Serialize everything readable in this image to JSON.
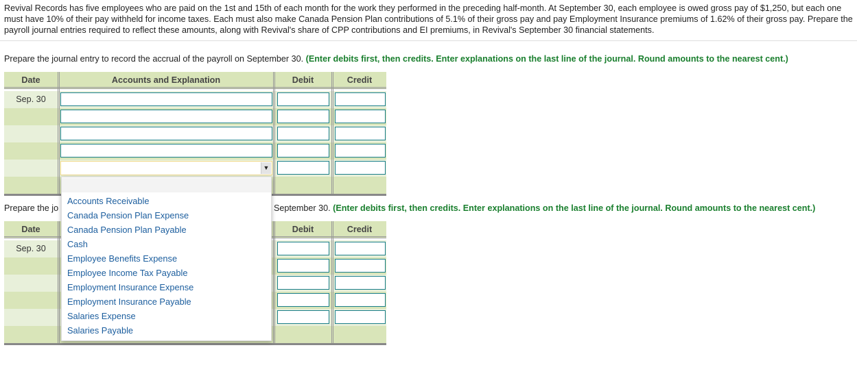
{
  "problem_text": "Revival Records has five employees who are paid on the 1st and 15th of each month for the work they performed in the preceding half-month. At September 30, each employee is owed gross pay of $1,250, but each one must have 10% of their pay withheld for income taxes. Each must also make Canada Pension Plan contributions of 5.1% of their gross pay and pay Employment Insurance premiums of 1.62% of their gross pay. Prepare the payroll journal entries required to reflect these amounts, along with Revival's share of CPP contributions and EI premiums, in Revival's September 30 financial statements.",
  "part1": {
    "instruction": "Prepare the journal entry to record the accrual of the payroll on September 30.",
    "note": "(Enter debits first, then credits. Enter explanations on the last line of the journal. Round amounts to the nearest cent.)",
    "date": "Sep. 30"
  },
  "part2": {
    "instruction_left": "Prepare the jo",
    "instruction_right": "September 30.",
    "note": "(Enter debits first, then credits. Enter explanations on the last line of the journal. Round amounts to the nearest cent.)",
    "date": "Sep. 30"
  },
  "headers": {
    "date": "Date",
    "accounts": "Accounts and Explanation",
    "debit": "Debit",
    "credit": "Credit"
  },
  "dropdown": {
    "options": [
      "Accounts Receivable",
      "Canada Pension Plan Expense",
      "Canada Pension Plan Payable",
      "Cash",
      "Employee Benefits Expense",
      "Employee Income Tax Payable",
      "Employment Insurance Expense",
      "Employment Insurance Payable",
      "Salaries Expense",
      "Salaries Payable"
    ]
  },
  "colors": {
    "header": "#d9e5b9",
    "row_light": "#e8f0da",
    "instruction_green": "#1a7f2e",
    "link_blue": "#1c5e9e",
    "input_border": "#1a7f8a"
  }
}
